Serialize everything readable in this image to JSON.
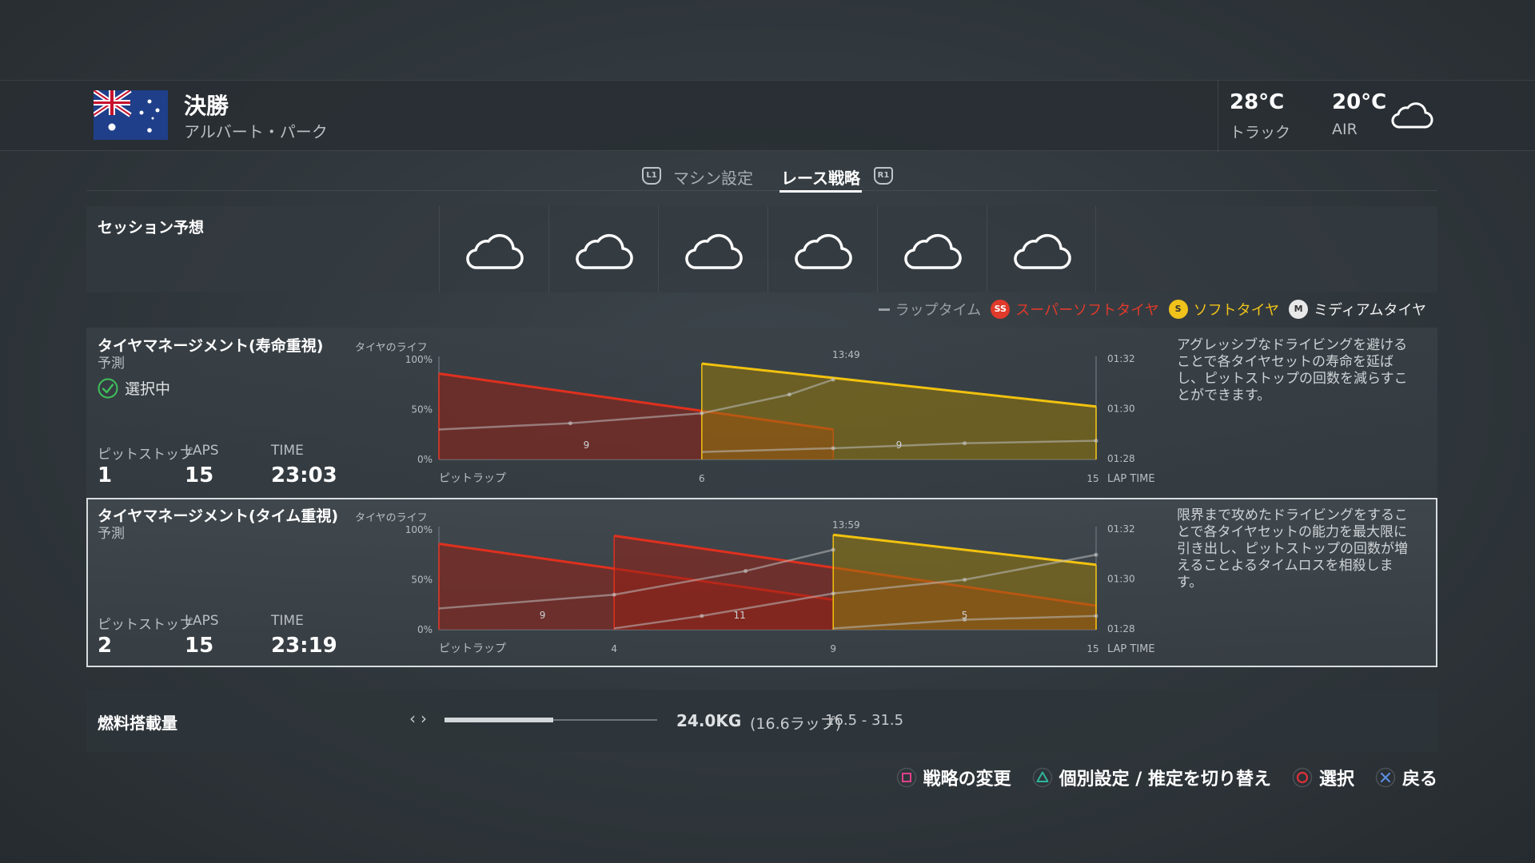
{
  "header": {
    "title": "決勝",
    "circuit": "アルバート・パーク",
    "track_temp": "28°C",
    "track_label": "トラック",
    "air_temp": "20°C",
    "air_label": "AIR",
    "weather_icon": "cloud-icon"
  },
  "tabs": [
    {
      "button": "L1",
      "label": "マシン設定",
      "active": false
    },
    {
      "label": "レース戦略",
      "active": true,
      "button": "R1"
    }
  ],
  "session": {
    "label": "セッション予想",
    "forecast": [
      "cloud-icon",
      "cloud-icon",
      "cloud-icon",
      "cloud-icon",
      "cloud-icon",
      "cloud-icon"
    ]
  },
  "legend": {
    "lap_time": "ラップタイム",
    "supersoft": {
      "badge": "SS",
      "label": "スーパーソフトタイヤ",
      "color": "#e03a2a"
    },
    "soft": {
      "badge": "S",
      "label": "ソフトタイヤ",
      "color": "#f0c21a"
    },
    "medium": {
      "badge": "M",
      "label": "ミディアムタイヤ",
      "color": "#e8e8e8"
    }
  },
  "strategies": [
    {
      "title": "タイヤマネージメント(寿命重視)",
      "life_label": "タイヤのライフ",
      "predict": "予測",
      "status": "選択中",
      "pit_label": "ピットストップ",
      "laps_label": "LAPS",
      "time_label": "TIME",
      "pit_stops": "1",
      "laps": "15",
      "time": "23:03",
      "description": "アグレッシブなドライビングを避けることで各タイヤセットの寿命を延ばし、ピットストップの回数を減らすことができます。",
      "chart_data": {
        "type": "area",
        "total_time": "13:49",
        "x_label": "ピットラップ",
        "y_label_right": "LAP TIME",
        "y_ticks": [
          "100%",
          "50%",
          "0%"
        ],
        "y_ticks_right": [
          "01:32",
          "01:30",
          "01:28"
        ],
        "x_ticks": [
          "6",
          "15"
        ],
        "stints": [
          {
            "tyre": "supersoft",
            "start_lap": 0,
            "end_lap": 9,
            "life_start": 86,
            "life_end": 30,
            "lap_count": "9"
          },
          {
            "tyre": "soft",
            "start_lap": 6,
            "end_lap": 15,
            "life_start": 96,
            "life_end": 53,
            "lap_count": "9"
          }
        ],
        "lap_time_lines": [
          [
            [
              0,
              1.2
            ],
            [
              3,
              1.45
            ],
            [
              6,
              1.85
            ],
            [
              8,
              2.6
            ],
            [
              9,
              3.2
            ]
          ],
          [
            [
              6,
              0.3
            ],
            [
              9,
              0.45
            ],
            [
              12,
              0.65
            ],
            [
              15,
              0.75
            ]
          ]
        ]
      }
    },
    {
      "title": "タイヤマネージメント(タイム重視)",
      "life_label": "タイヤのライフ",
      "predict": "予測",
      "status": "",
      "pit_label": "ピットストップ",
      "laps_label": "LAPS",
      "time_label": "TIME",
      "pit_stops": "2",
      "laps": "15",
      "time": "23:19",
      "description": "限界まで攻めたドライビングをすることで各タイヤセットの能力を最大限に引き出し、ピットストップの回数が増えることよるタイムロスを相殺します。",
      "chart_data": {
        "type": "area",
        "total_time": "13:59",
        "x_label": "ピットラップ",
        "y_label_right": "LAP TIME",
        "y_ticks": [
          "100%",
          "50%",
          "0%"
        ],
        "y_ticks_right": [
          "01:32",
          "01:30",
          "01:28"
        ],
        "x_ticks": [
          "4",
          "9",
          "15"
        ],
        "stints": [
          {
            "tyre": "supersoft",
            "start_lap": 0,
            "end_lap": 9,
            "life_start": 86,
            "life_end": 30,
            "lap_count": "9"
          },
          {
            "tyre": "supersoft",
            "start_lap": 4,
            "end_lap": 15,
            "life_start": 94,
            "life_end": 24,
            "lap_count": "11"
          },
          {
            "tyre": "soft",
            "start_lap": 9,
            "end_lap": 15,
            "life_start": 95,
            "life_end": 65,
            "lap_count": "5"
          }
        ],
        "lap_time_lines": [
          [
            [
              0,
              0.85
            ],
            [
              4,
              1.4
            ],
            [
              7,
              2.35
            ],
            [
              9,
              3.2
            ]
          ],
          [
            [
              4,
              0.05
            ],
            [
              6,
              0.55
            ],
            [
              9,
              1.45
            ],
            [
              12,
              2.0
            ],
            [
              15,
              3.0
            ]
          ],
          [
            [
              9,
              0.05
            ],
            [
              12,
              0.4
            ],
            [
              15,
              0.55
            ]
          ]
        ]
      }
    }
  ],
  "fuel": {
    "label": "燃料搭載量",
    "level": 0.51,
    "amount": "24.0KG",
    "laps": "(16.6ラップ)",
    "range": "16.5 - 31.5"
  },
  "footer": [
    {
      "icon": "square-button-icon",
      "color": "#e0408a",
      "label": "戦略の変更"
    },
    {
      "icon": "triangle-button-icon",
      "color": "#2fb59a",
      "label": "個別設定 / 推定を切り替え"
    },
    {
      "icon": "circle-button-icon",
      "color": "#e0303a",
      "label": "選択"
    },
    {
      "icon": "cross-button-icon",
      "color": "#5a8de0",
      "label": "戻る"
    }
  ]
}
